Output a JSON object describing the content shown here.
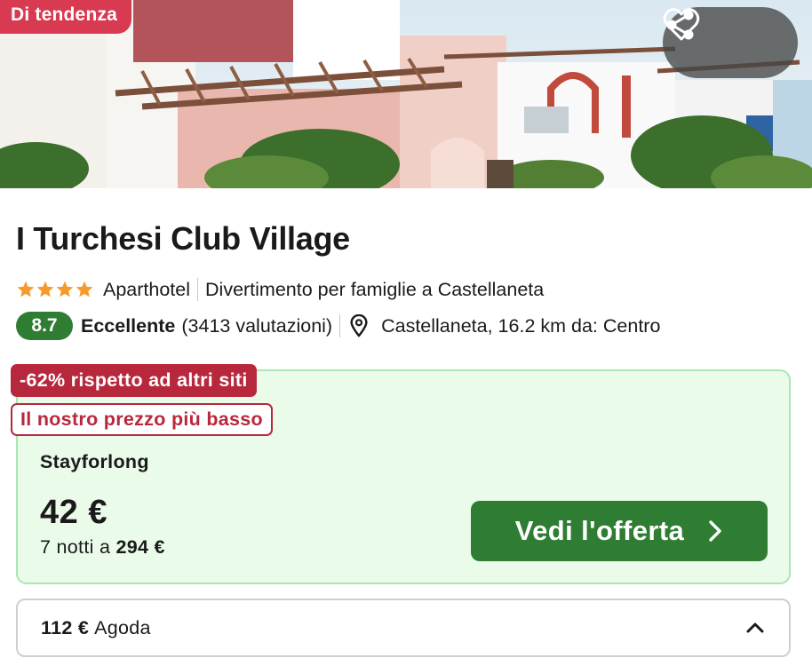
{
  "hero": {
    "badge": "Di tendenza",
    "share_icon": "share-icon",
    "favorite_icon": "heart-icon"
  },
  "hotel": {
    "name": "I Turchesi Club Village",
    "stars": 4,
    "type": "Aparthotel",
    "tagline": "Divertimento per famiglie a Castellaneta",
    "score": "8.7",
    "score_label": "Eccellente",
    "reviews": "(3413 valutazioni)",
    "location": "Castellaneta, 16.2 km da: Centro"
  },
  "offer": {
    "discount": "-62% rispetto ad altri siti",
    "lowest": "Il nostro prezzo più basso",
    "provider": "Stayforlong",
    "price": "42 €",
    "nights_prefix": "7 notti a",
    "nights_total": "294 €",
    "cta_label": "Vedi l'offerta"
  },
  "alt_offer": {
    "price": "112 €",
    "provider": "Agoda"
  },
  "colors": {
    "accent_green": "#2e7d32",
    "badge_red": "#d83a52",
    "discount_red": "#b8283d",
    "star_orange": "#f59a2b"
  }
}
